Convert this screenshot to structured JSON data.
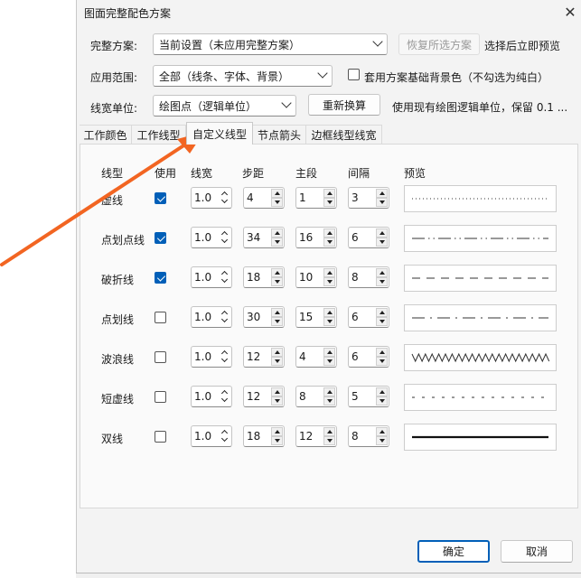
{
  "dialog": {
    "title": "图面完整配色方案",
    "close_glyph": "✕",
    "scheme_label": "完整方案:",
    "scheme_value": "当前设置（未应用完整方案）",
    "restore_button": "恢复所选方案",
    "preview_hint": "选择后立即预览",
    "scope_label": "应用范围:",
    "scope_value": "全部（线条、字体、背景）",
    "bg_checkbox_label": "套用方案基础背景色（不勾选为纯白）",
    "unit_label": "线宽单位:",
    "unit_value": "绘图点（逻辑单位）",
    "recalc_button": "重新换算",
    "unit_hint": "使用现有绘图逻辑单位，保留 0.1 ..."
  },
  "tabs": [
    {
      "label": "工作颜色"
    },
    {
      "label": "工作线型"
    },
    {
      "label": "自定义线型"
    },
    {
      "label": "节点箭头"
    },
    {
      "label": "边框线型线宽"
    }
  ],
  "columns": [
    "线型",
    "使用",
    "线宽",
    "步距",
    "主段",
    "间隔",
    "预览"
  ],
  "rows": [
    {
      "name": "虚线",
      "use": true,
      "width": "1.0",
      "step": "4",
      "main": "1",
      "gap": "3",
      "pattern": "dotted"
    },
    {
      "name": "点划点线",
      "use": true,
      "width": "1.0",
      "step": "34",
      "main": "16",
      "gap": "6",
      "pattern": "dashdotdot"
    },
    {
      "name": "破折线",
      "use": true,
      "width": "1.0",
      "step": "18",
      "main": "10",
      "gap": "8",
      "pattern": "dashed"
    },
    {
      "name": "点划线",
      "use": false,
      "width": "1.0",
      "step": "30",
      "main": "15",
      "gap": "6",
      "pattern": "dashdot"
    },
    {
      "name": "波浪线",
      "use": false,
      "width": "1.0",
      "step": "12",
      "main": "4",
      "gap": "6",
      "pattern": "wave"
    },
    {
      "name": "短虚线",
      "use": false,
      "width": "1.0",
      "step": "12",
      "main": "8",
      "gap": "5",
      "pattern": "shortdash"
    },
    {
      "name": "双线",
      "use": false,
      "width": "1.0",
      "step": "18",
      "main": "12",
      "gap": "8",
      "pattern": "double"
    }
  ],
  "footer": {
    "ok": "确定",
    "cancel": "取消"
  },
  "colors": {
    "accent": "#005fb8",
    "annotation_arrow": "#f26522"
  }
}
